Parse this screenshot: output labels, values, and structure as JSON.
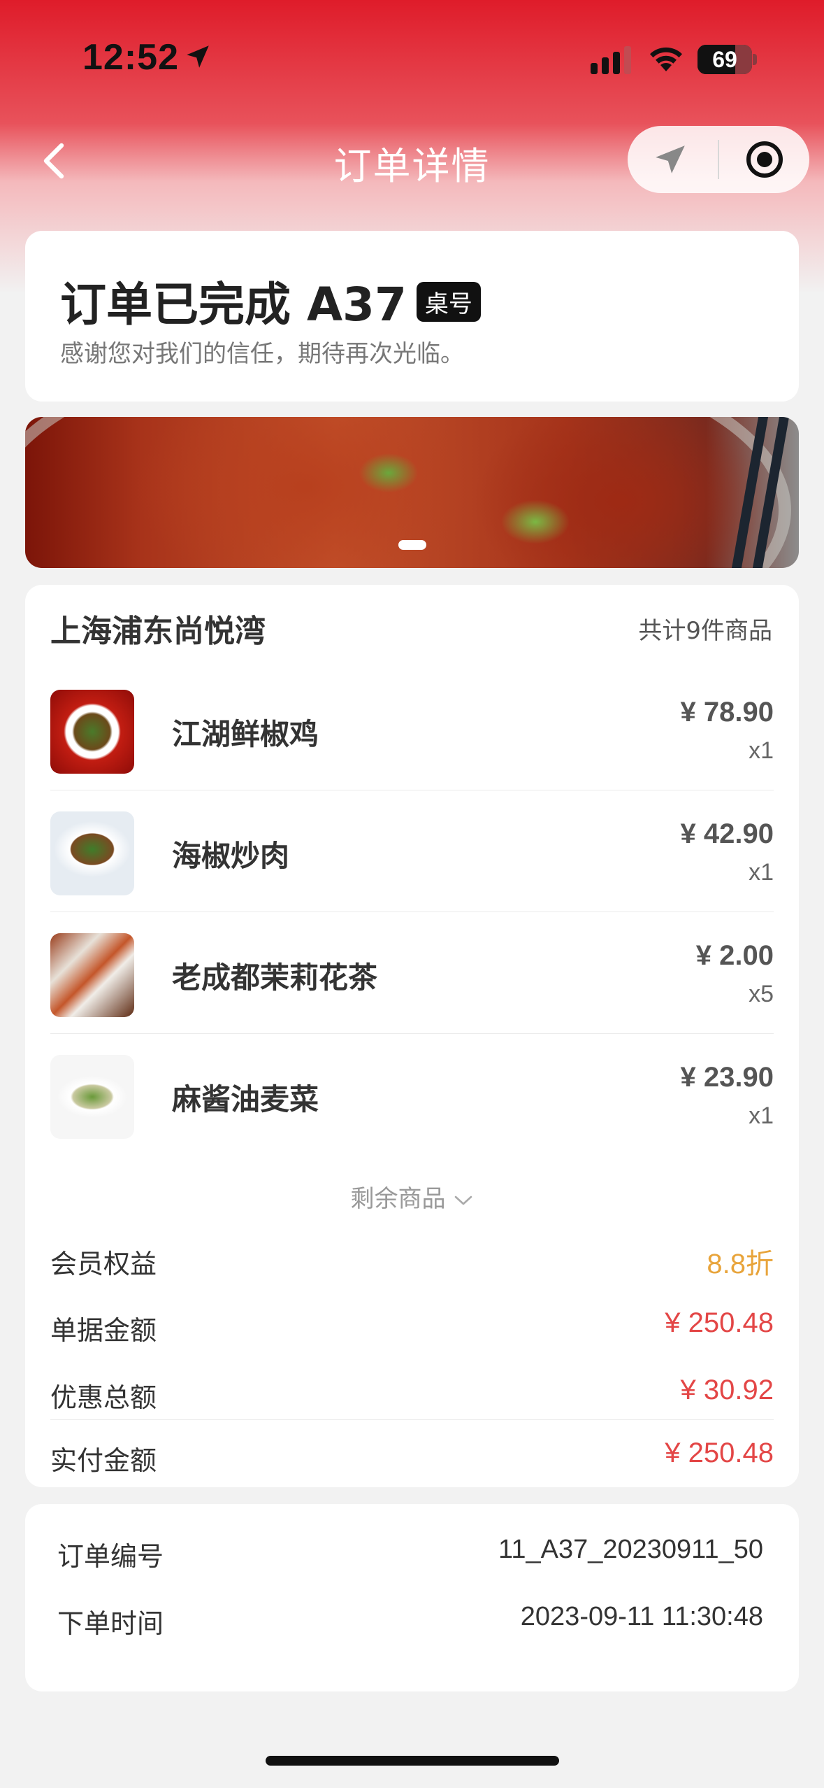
{
  "status_bar": {
    "time": "12:52",
    "battery": "69",
    "battery_level": 0.69
  },
  "nav": {
    "title": "订单详情",
    "icons": [
      "back-arrow-icon",
      "share-location-icon",
      "record-target-icon"
    ]
  },
  "order_status": {
    "title": "订单已完成 A37",
    "badge": "桌号",
    "subtitle": "感谢您对我们的信任，期待再次光临。"
  },
  "store": {
    "name": "上海浦东尚悦湾",
    "item_count": "共计9件商品"
  },
  "items": [
    {
      "name": "江湖鲜椒鸡",
      "price": "¥ 78.90",
      "qty": "x1"
    },
    {
      "name": "海椒炒肉",
      "price": "¥ 42.90",
      "qty": "x1"
    },
    {
      "name": "老成都茉莉花茶",
      "price": "¥ 2.00",
      "qty": "x5"
    },
    {
      "name": "麻酱油麦菜",
      "price": "¥ 23.90",
      "qty": "x1"
    }
  ],
  "more_items_label": "剩余商品",
  "summary": [
    {
      "label": "会员权益",
      "value": "8.8折",
      "color": "#e8a43b"
    },
    {
      "label": "单据金额",
      "value": "¥ 250.48",
      "color": "#e34646"
    },
    {
      "label": "优惠总额",
      "value": "¥ 30.92",
      "color": "#e34646"
    },
    {
      "label": "实付金额",
      "value": "¥ 250.48",
      "color": "#e34646"
    }
  ],
  "order_info": [
    {
      "label": "订单编号",
      "value": "11_A37_20230911_50"
    },
    {
      "label": "下单时间",
      "value": "2023-09-11 11:30:48"
    }
  ],
  "colors": {
    "brand_red": "#df1c2a",
    "price_red": "#e34646",
    "discount_orange": "#e8a43b"
  }
}
